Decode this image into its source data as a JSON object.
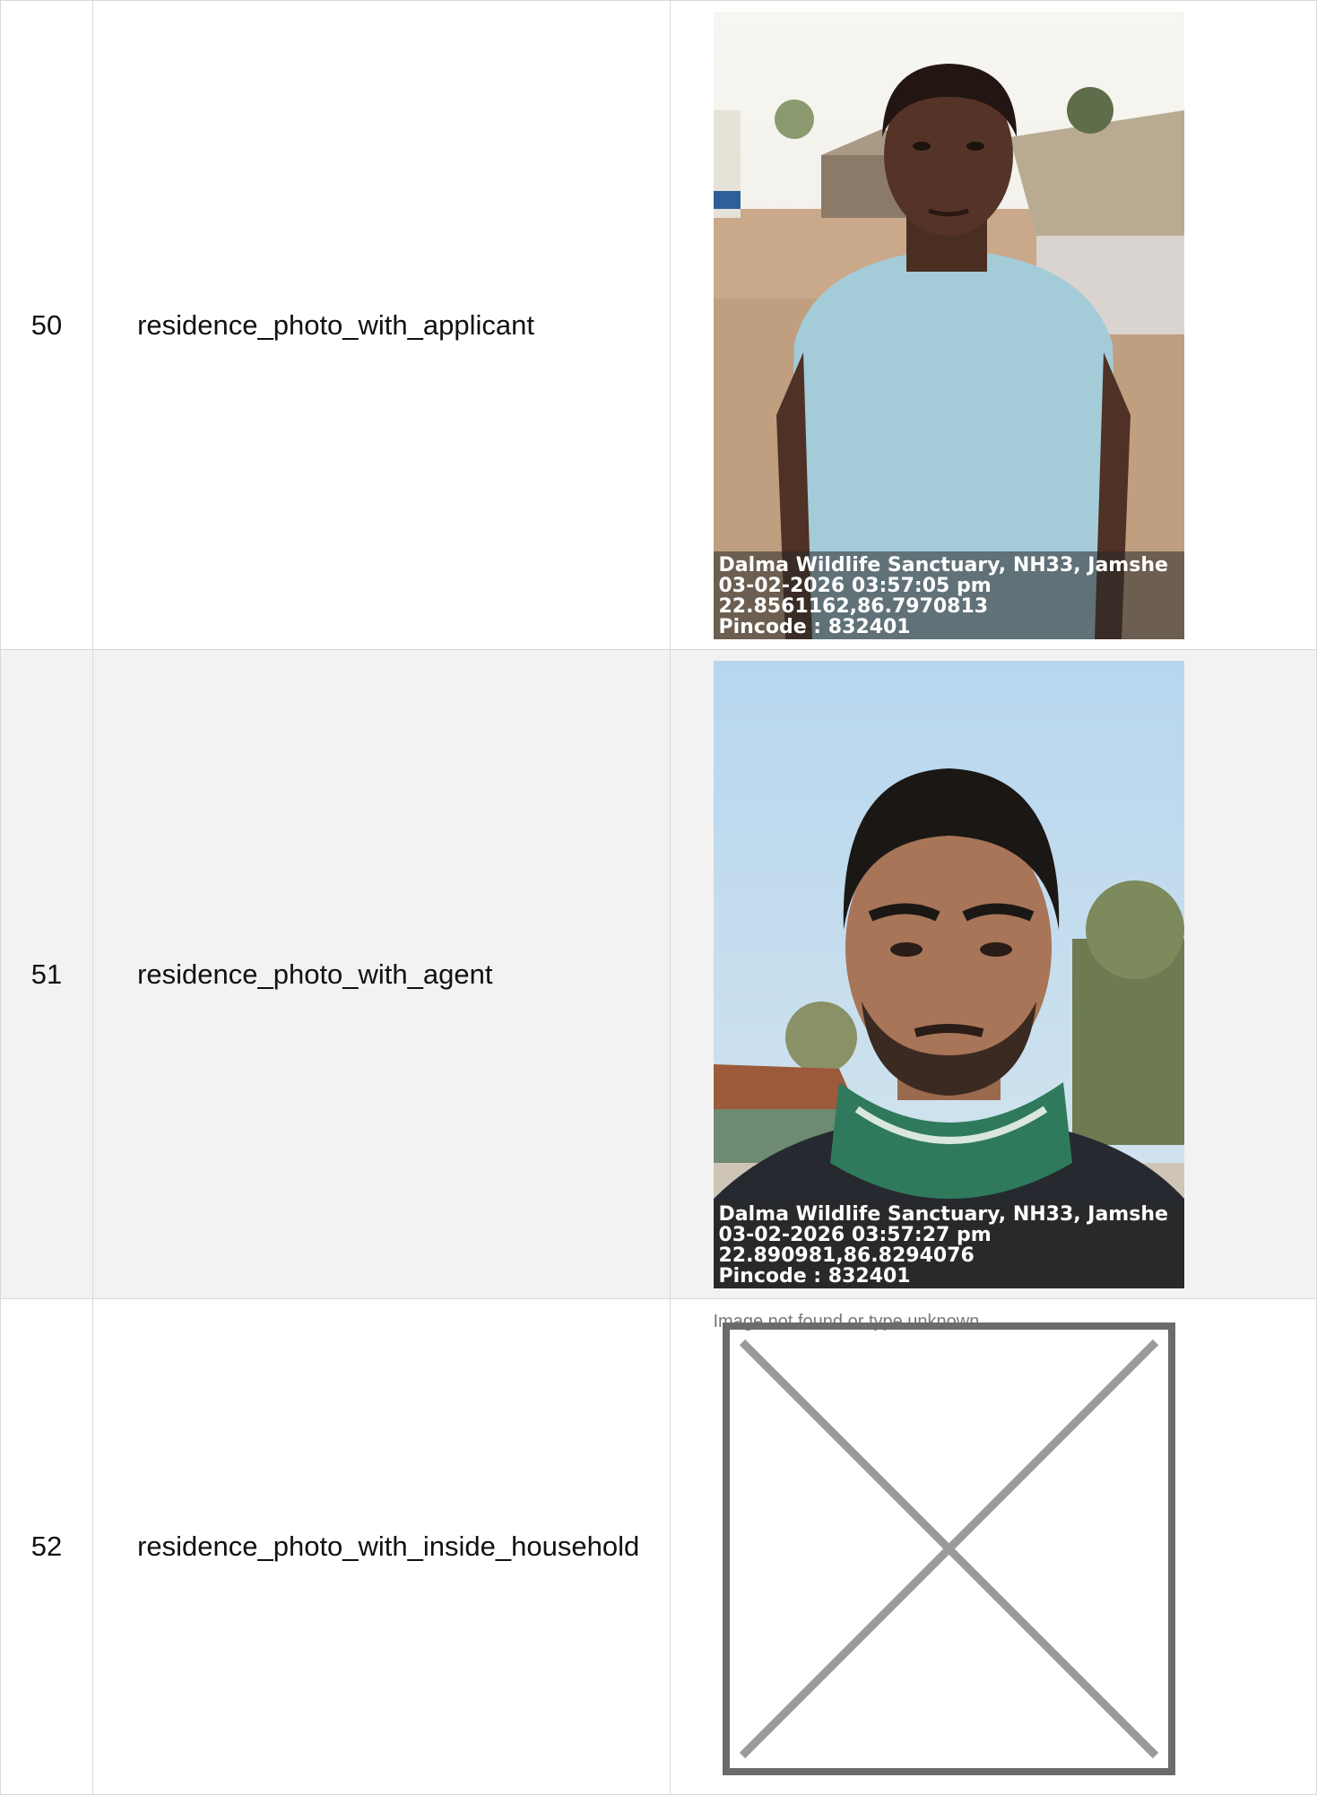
{
  "rows": [
    {
      "number": "50",
      "field": "residence_photo_with_applicant",
      "photo": {
        "location": "Dalma Wildlife Sanctuary, NH33, Jamshe",
        "datetime": "03-02-2026 03:57:05 pm",
        "coords": "22.8561162,86.7970813",
        "pincode": "Pincode : 832401"
      }
    },
    {
      "number": "51",
      "field": "residence_photo_with_agent",
      "photo": {
        "location": "Dalma Wildlife Sanctuary, NH33, Jamshe",
        "datetime": "03-02-2026 03:57:27 pm",
        "coords": "22.890981,86.8294076",
        "pincode": "Pincode : 832401"
      }
    },
    {
      "number": "52",
      "field": "residence_photo_with_inside_household",
      "broken_image_text": "Image not found or type unknown"
    }
  ]
}
